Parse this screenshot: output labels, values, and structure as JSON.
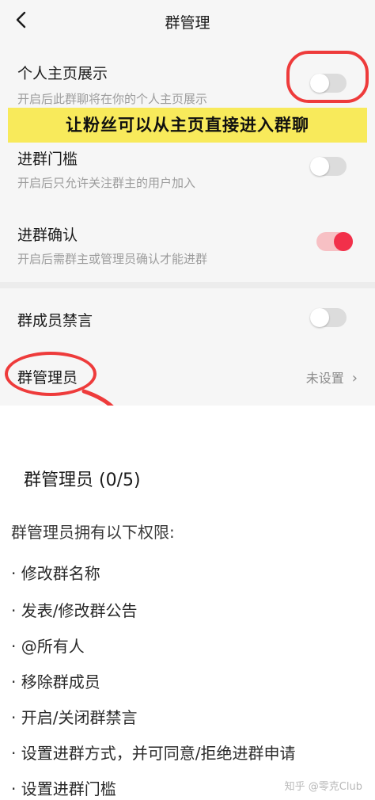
{
  "header": {
    "title": "群管理"
  },
  "annotation": {
    "banner": "让粉丝可以从主页直接进入群聊"
  },
  "settings": {
    "profile_display": {
      "title": "个人主页展示",
      "desc": "开启后此群聊将在你的个人主页展示",
      "enabled": false
    },
    "join_threshold": {
      "title": "进群门槛",
      "desc": "开启后只允许关注群主的用户加入",
      "enabled": false
    },
    "join_confirm": {
      "title": "进群确认",
      "desc": "开启后需群主或管理员确认才能进群",
      "enabled": true
    },
    "mute_members": {
      "title": "群成员禁言",
      "enabled": false
    },
    "admins": {
      "title": "群管理员",
      "value": "未设置",
      "chevron": "›"
    }
  },
  "admin_panel": {
    "title": "群管理员 (0/5)",
    "intro": "群管理员拥有以下权限:",
    "permissions": [
      "· 修改群名称",
      "· 发表/修改群公告",
      "· @所有人",
      "· 移除群成员",
      "· 开启/关闭群禁言",
      "· 设置进群方式，并可同意/拒绝进群申请",
      "· 设置进群门槛"
    ]
  },
  "watermark": "知乎 @零克Club",
  "colors": {
    "accent": "#f2304a",
    "annotation_red": "#ee3b3b",
    "banner_yellow": "#f8ea5b"
  },
  "icons": {
    "back": "chevron-left-icon"
  }
}
